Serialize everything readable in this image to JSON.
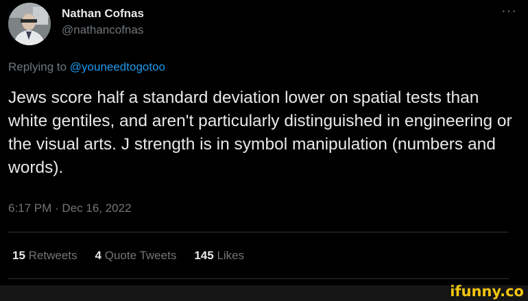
{
  "author": {
    "display_name": "Nathan Cofnas",
    "handle": "@nathancofnas",
    "avatar_icon": "profile-photo"
  },
  "more_icon": "ellipsis-icon",
  "more_glyph": "···",
  "reply": {
    "prefix": "Replying to ",
    "mention": "@youneedtogotoo"
  },
  "tweet_text": "Jews score half a standard deviation lower on spatial tests than white gentiles, and aren't particularly distinguished in engineering or the visual arts. J strength is in symbol manipulation (numbers and words).",
  "timestamp": "6:17 PM · Dec 16, 2022",
  "stats": {
    "retweets": {
      "count": "15",
      "label": "Retweets"
    },
    "quote_tweets": {
      "count": "4",
      "label": "Quote Tweets"
    },
    "likes": {
      "count": "145",
      "label": "Likes"
    }
  },
  "watermark": "ifunny.co",
  "colors": {
    "background": "#000000",
    "text": "#e7e9ea",
    "secondary": "#71767b",
    "link": "#1d9bf0",
    "divider": "#2f3336",
    "watermark": "#f1c40f"
  }
}
